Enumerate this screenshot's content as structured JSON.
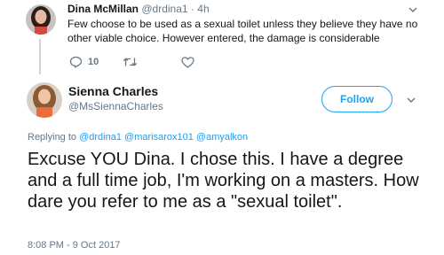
{
  "parent_tweet": {
    "name": "Dina McMillan",
    "handle": "@drdina1",
    "separator": "·",
    "time": "4h",
    "text": "Few choose to be used as a sexual toilet unless they believe they have no other viable choice. However entered, the damage is considerable",
    "reply_count": "10",
    "icons": {
      "reply": "reply-icon",
      "retweet": "retweet-icon",
      "like": "heart-icon",
      "menu": "chevron-down-icon"
    }
  },
  "main_tweet": {
    "name": "Sienna Charles",
    "handle": "@MsSiennaCharles",
    "follow_label": "Follow",
    "replying_to_label": "Replying to",
    "mentions": [
      "@drdina1",
      "@marisarox101",
      "@amyalkon"
    ],
    "text": "Excuse YOU Dina. I chose this. I have a degree and a full time job, I'm working on a masters. How dare you refer to me as a \"sexual toilet\".",
    "timestamp": "8:08 PM - 9 Oct 2017"
  },
  "colors": {
    "accent": "#1da1f2",
    "text": "#14171a",
    "muted": "#657786",
    "thread_line": "#ccd6dd"
  }
}
